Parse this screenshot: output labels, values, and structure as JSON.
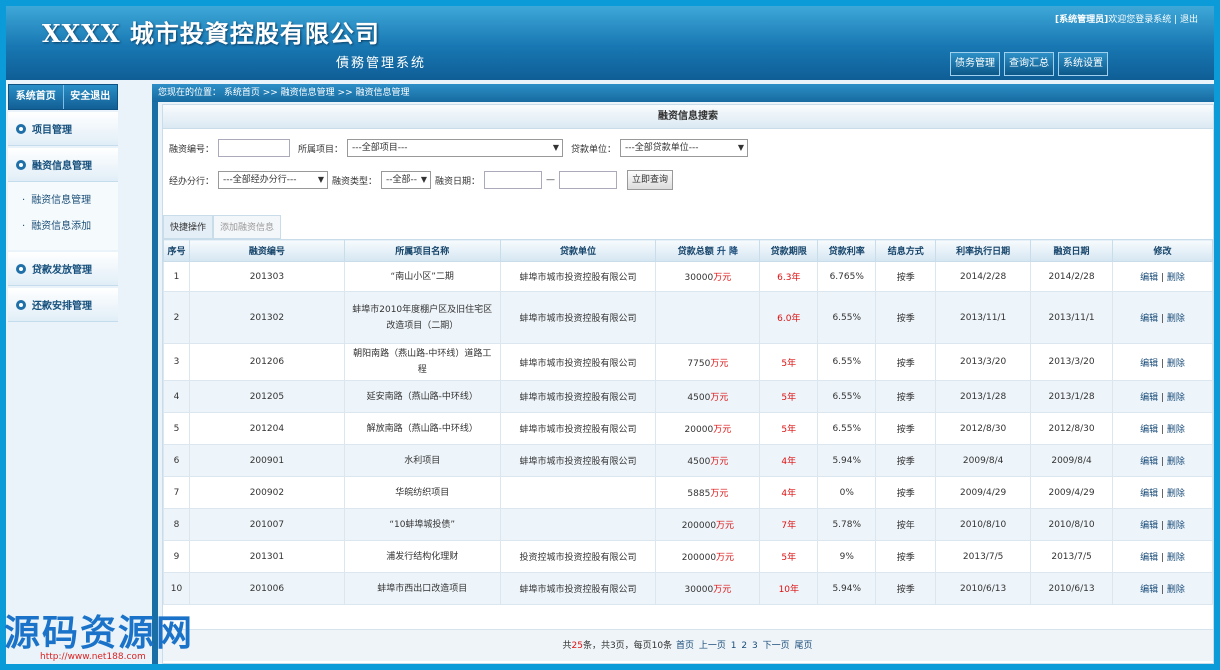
{
  "header": {
    "company_title": "XXXX 城市投資控股有限公司",
    "system_subtitle": "債務管理系统",
    "user_role": "[系统管理员]",
    "welcome": "欢迎您登录系统",
    "logout": "退出",
    "nav": [
      "债务管理",
      "查询汇总",
      "系统设置"
    ]
  },
  "sidebar": {
    "top": [
      "系统首页",
      "安全退出"
    ],
    "sections": [
      {
        "label": "项目管理"
      },
      {
        "label": "融资信息管理",
        "items": [
          "融资信息管理",
          "融资信息添加"
        ]
      },
      {
        "label": "贷款发放管理"
      },
      {
        "label": "还款安排管理"
      }
    ]
  },
  "breadcrumb": "您现在的位置： 系统首页 >> 融资信息管理 >> 融资信息管理",
  "search": {
    "title": "融资信息搜索",
    "code_label": "融资编号：",
    "project_label": "所属项目：",
    "project_value": "---全部项目---",
    "lender_label": "贷款单位：",
    "lender_value": "---全部贷款单位---",
    "branch_label": "经办分行：",
    "branch_value": "---全部经办分行---",
    "type_label": "融资类型：",
    "type_value": "--全部--",
    "date_label": "融资日期：",
    "date_sep": "—",
    "button": "立即查询"
  },
  "tabs": [
    "快捷操作",
    "添加融资信息"
  ],
  "table": {
    "headers": [
      "序号",
      "融资编号",
      "所属项目名称",
      "贷款单位",
      "贷款总额",
      "升",
      "降",
      "贷款期限",
      "贷款利率",
      "结息方式",
      "利率执行日期",
      "融资日期",
      "修改"
    ],
    "rows": [
      {
        "no": "1",
        "code": "201303",
        "project": "“南山小区”二期",
        "lender": "蚌埠市城市投资控股有限公司",
        "amount": "30000",
        "unit": "万元",
        "term": "6.3",
        "term_unit": "年",
        "rate": "6.765%",
        "method": "按季",
        "rate_date": "2014/2/28",
        "date": "2014/2/28",
        "edit": "编辑",
        "sep": "|",
        "del": "删除"
      },
      {
        "no": "2",
        "code": "201302",
        "project": "蚌埠市2010年度棚户区及旧住宅区改造项目（二期）",
        "lender": "蚌埠市城市投资控股有限公司",
        "amount": "",
        "unit": "",
        "term": "6.0",
        "term_unit": "年",
        "rate": "6.55%",
        "method": "按季",
        "rate_date": "2013/11/1",
        "date": "2013/11/1",
        "edit": "编辑",
        "sep": "|",
        "del": "删除"
      },
      {
        "no": "3",
        "code": "201206",
        "project": "朝阳南路（燕山路-中环线）道路工程",
        "lender": "蚌埠市城市投资控股有限公司",
        "amount": "7750",
        "unit": "万元",
        "term": "5",
        "term_unit": "年",
        "rate": "6.55%",
        "method": "按季",
        "rate_date": "2013/3/20",
        "date": "2013/3/20",
        "edit": "编辑",
        "sep": "|",
        "del": "删除"
      },
      {
        "no": "4",
        "code": "201205",
        "project": "延安南路（燕山路-中环线）",
        "lender": "蚌埠市城市投资控股有限公司",
        "amount": "4500",
        "unit": "万元",
        "term": "5",
        "term_unit": "年",
        "rate": "6.55%",
        "method": "按季",
        "rate_date": "2013/1/28",
        "date": "2013/1/28",
        "edit": "编辑",
        "sep": "|",
        "del": "删除"
      },
      {
        "no": "5",
        "code": "201204",
        "project": "解放南路（燕山路-中环线）",
        "lender": "蚌埠市城市投资控股有限公司",
        "amount": "20000",
        "unit": "万元",
        "term": "5",
        "term_unit": "年",
        "rate": "6.55%",
        "method": "按季",
        "rate_date": "2012/8/30",
        "date": "2012/8/30",
        "edit": "编辑",
        "sep": "|",
        "del": "删除"
      },
      {
        "no": "6",
        "code": "200901",
        "project": "水利项目",
        "lender": "蚌埠市城市投资控股有限公司",
        "amount": "4500",
        "unit": "万元",
        "term": "4",
        "term_unit": "年",
        "rate": "5.94%",
        "method": "按季",
        "rate_date": "2009/8/4",
        "date": "2009/8/4",
        "edit": "编辑",
        "sep": "|",
        "del": "删除"
      },
      {
        "no": "7",
        "code": "200902",
        "project": "华皖纺织项目",
        "lender": "",
        "amount": "5885",
        "unit": "万元",
        "term": "4",
        "term_unit": "年",
        "rate": "0%",
        "method": "按季",
        "rate_date": "2009/4/29",
        "date": "2009/4/29",
        "edit": "编辑",
        "sep": "|",
        "del": "删除"
      },
      {
        "no": "8",
        "code": "201007",
        "project": "“10蚌埠城投债”",
        "lender": "",
        "amount": "200000",
        "unit": "万元",
        "term": "7",
        "term_unit": "年",
        "rate": "5.78%",
        "method": "按年",
        "rate_date": "2010/8/10",
        "date": "2010/8/10",
        "edit": "编辑",
        "sep": "|",
        "del": "删除"
      },
      {
        "no": "9",
        "code": "201301",
        "project": "浦发行结构化理财",
        "lender": "投资控城市投资控股有限公司",
        "amount": "200000",
        "unit": "万元",
        "term": "5",
        "term_unit": "年",
        "rate": "9%",
        "method": "按季",
        "rate_date": "2013/7/5",
        "date": "2013/7/5",
        "edit": "编辑",
        "sep": "|",
        "del": "删除"
      },
      {
        "no": "10",
        "code": "201006",
        "project": "蚌埠市西出口改造项目",
        "lender": "蚌埠市城市投资控股有限公司",
        "amount": "30000",
        "unit": "万元",
        "term": "10",
        "term_unit": "年",
        "rate": "5.94%",
        "method": "按季",
        "rate_date": "2010/6/13",
        "date": "2010/6/13",
        "edit": "编辑",
        "sep": "|",
        "del": "删除"
      }
    ]
  },
  "pager": {
    "total_prefix": "共",
    "total": "25",
    "total_suffix": "条，共3页，每页10条",
    "first": "首页",
    "prev": "上一页",
    "pages": [
      "1",
      "2",
      "3"
    ],
    "next": "下一页",
    "last": "尾页"
  },
  "watermark": {
    "text": "源码资源网",
    "url": "http://www.net188.com"
  }
}
